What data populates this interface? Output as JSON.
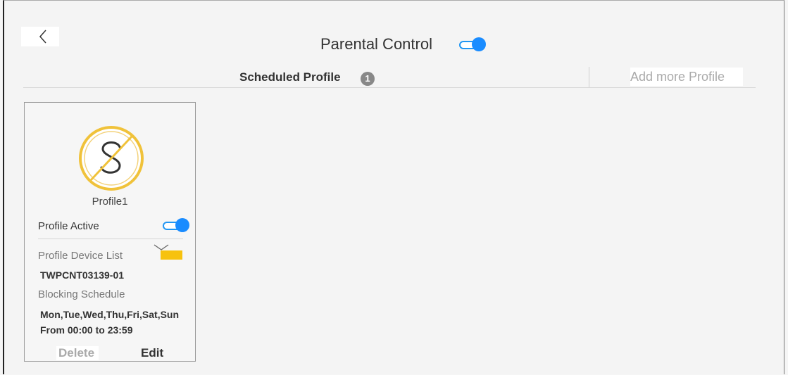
{
  "header": {
    "title": "Parental Control",
    "parental_control_enabled": true
  },
  "tabs": {
    "scheduled_label": "Scheduled Profile",
    "scheduled_count": "1",
    "add_label": "Add more Profile"
  },
  "profile": {
    "name": "Profile1",
    "active_label": "Profile Active",
    "active": true,
    "device_list_label": "Profile Device List",
    "device": "TWPCNT03139-01",
    "schedule_label": "Blocking Schedule",
    "schedule_days": "Mon,Tue,Wed,Thu,Fri,Sat,Sun",
    "schedule_time": "From 00:00 to 23:59",
    "delete_label": "Delete",
    "edit_label": "Edit"
  },
  "icons": {
    "back": "chevron-left-icon",
    "profile": "no-schedule-icon",
    "dropdown": "chevron-down-icon"
  },
  "colors": {
    "accent": "#1a8cff",
    "highlight": "#f7c20e",
    "profile_icon": "#f0c23a"
  }
}
